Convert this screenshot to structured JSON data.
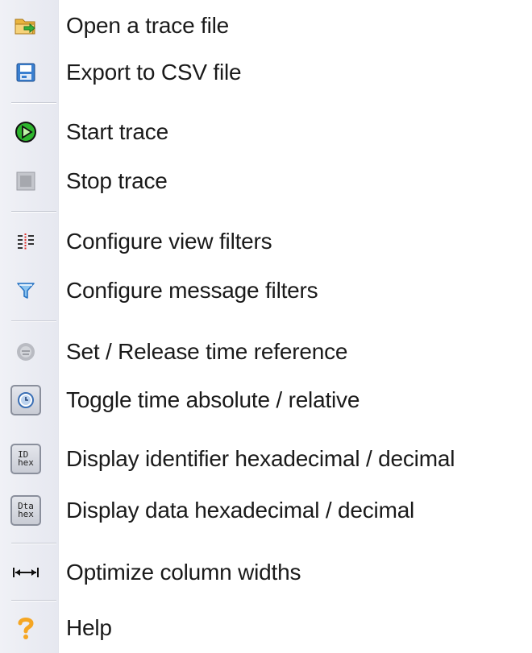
{
  "menu": {
    "items": [
      {
        "label": "Open a trace file",
        "icon": "open-folder-icon"
      },
      {
        "label": "Export to CSV file",
        "icon": "export-csv-icon"
      },
      {
        "label": "Start trace",
        "icon": "start-trace-icon"
      },
      {
        "label": "Stop trace",
        "icon": "stop-trace-icon"
      },
      {
        "label": "Configure view filters",
        "icon": "view-filters-icon"
      },
      {
        "label": "Configure message filters",
        "icon": "funnel-icon"
      },
      {
        "label": "Set / Release time reference",
        "icon": "time-reference-icon"
      },
      {
        "label": "Toggle time absolute / relative",
        "icon": "clock-icon"
      },
      {
        "label": "Display identifier hexadecimal / decimal",
        "icon": "id-hex-icon",
        "icon_text": [
          "ID",
          "hex"
        ]
      },
      {
        "label": "Display data hexadecimal / decimal",
        "icon": "dta-hex-icon",
        "icon_text": [
          "Dta",
          "hex"
        ]
      },
      {
        "label": "Optimize column widths",
        "icon": "column-width-icon"
      },
      {
        "label": "Help",
        "icon": "help-icon"
      }
    ]
  },
  "colors": {
    "gutter": "#e6e8f0",
    "separator": "#c5c8d2",
    "start_green": "#2db52d",
    "folder_yellow": "#f2c14e",
    "filter_blue": "#3b8fd9",
    "help_orange": "#f5a623"
  }
}
